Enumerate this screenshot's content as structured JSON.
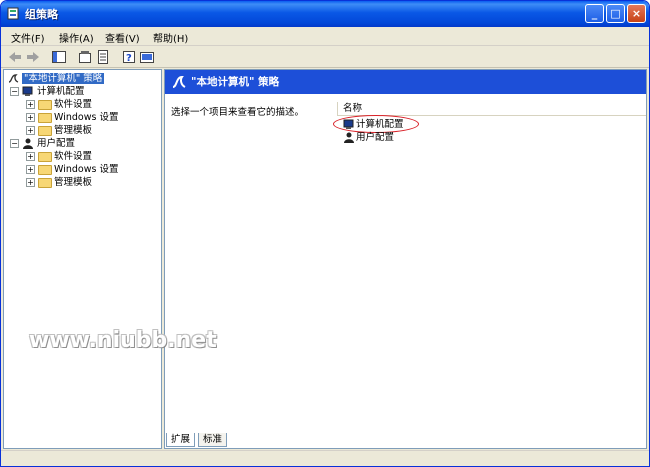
{
  "window": {
    "title": "组策略",
    "controls": {
      "minimize": "_",
      "maximize": "□",
      "close": "×"
    }
  },
  "menubar": [
    {
      "label": "文件(F)"
    },
    {
      "label": "操作(A)"
    },
    {
      "label": "查看(V)"
    },
    {
      "label": "帮助(H)"
    }
  ],
  "toolbar": {
    "icons": [
      "back-arrow-icon",
      "forward-arrow-icon",
      "show-tree-icon",
      "properties-icon",
      "export-list-icon",
      "help-icon",
      "console-icon"
    ]
  },
  "tree": {
    "root": "\"本地计算机\" 策略",
    "computer_config": {
      "label": "计算机配置",
      "children": [
        "软件设置",
        "Windows 设置",
        "管理模板"
      ]
    },
    "user_config": {
      "label": "用户配置",
      "children": [
        "软件设置",
        "Windows 设置",
        "管理模板"
      ]
    }
  },
  "right_pane": {
    "header": "\"本地计算机\" 策略",
    "description": "选择一个项目来查看它的描述。",
    "column_name": "名称",
    "items": [
      "计算机配置",
      "用户配置"
    ]
  },
  "tabs": [
    "扩展",
    "标准"
  ],
  "watermark": "www.niubb.net",
  "colors": {
    "title_blue": "#0a58e6",
    "header_blue": "#1d4fd8",
    "selection_blue": "#316ac5",
    "highlight_circle": "#d9232a"
  }
}
